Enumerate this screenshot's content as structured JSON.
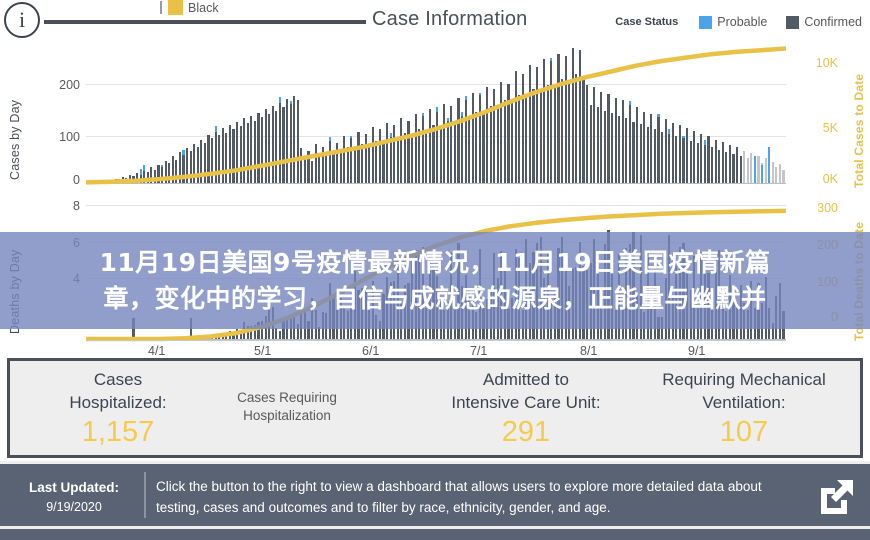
{
  "header": {
    "info_icon": "info-icon",
    "title": "Case Information",
    "legend_black_label": "Black",
    "case_status_label": "Case Status",
    "probable_label": "Probable",
    "confirmed_label": "Confirmed",
    "colors": {
      "gold": "#E8C146",
      "probable": "#4BA3EC",
      "confirmed": "#525A66",
      "dark": "#4A5059"
    }
  },
  "chart_data": {
    "type": "bar",
    "title": "Case Information",
    "xlabel": "",
    "legend": [
      "Black",
      "Probable",
      "Confirmed"
    ],
    "legend_position": "top",
    "grid": true,
    "panels": [
      {
        "name": "cases",
        "ylabel": "Cases by Day",
        "y2label": "Total Cases to Date",
        "yticks": [
          "0",
          "100",
          "200"
        ],
        "ylim": [
          0,
          260
        ],
        "y2ticks": [
          "0K",
          "5K",
          "10K"
        ],
        "y2lim": [
          0,
          12000
        ],
        "xticks": [
          "4/1",
          "5/1",
          "6/1",
          "7/1",
          "8/1",
          "9/1"
        ],
        "series": [
          {
            "name": "Confirmed",
            "type": "bar",
            "color": "#525A66",
            "values": [
              2,
              1,
              3,
              2,
              4,
              3,
              6,
              5,
              8,
              7,
              11,
              9,
              14,
              12,
              18,
              15,
              22,
              19,
              28,
              24,
              33,
              29,
              40,
              35,
              48,
              42,
              55,
              50,
              62,
              57,
              70,
              64,
              78,
              72,
              86,
              80,
              92,
              86,
              98,
              90,
              104,
              96,
              110,
              102,
              116,
              108,
              120,
              112,
              126,
              118,
              132,
              124,
              138,
              130,
              144,
              136,
              150,
              142,
              156,
              148,
              62,
              44,
              58,
              40,
              70,
              52,
              64,
              48,
              76,
              58,
              72,
              54,
              84,
              64,
              80,
              60,
              92,
              70,
              88,
              66,
              100,
              76,
              96,
              72,
              108,
              82,
              104,
              78,
              116,
              90,
              112,
              86,
              124,
              96,
              120,
              92,
              132,
              104,
              128,
              100,
              142,
              112,
              138,
              108,
              152,
              120,
              148,
              116,
              162,
              128,
              158,
              124,
              172,
              138,
              168,
              134,
              182,
              148,
              178,
              144,
              200,
              158,
              196,
              154,
              212,
              168,
              208,
              164,
              222,
              176,
              218,
              172,
              232,
              186,
              228,
              182,
              242,
              196,
              238,
              192,
              176,
              140,
              172,
              136,
              164,
              130,
              160,
              126,
              152,
              120,
              148,
              116,
              140,
              110,
              136,
              106,
              128,
              100,
              124,
              96,
              118,
              92,
              114,
              88,
              108,
              84,
              104,
              80,
              98,
              76,
              94,
              72,
              88,
              68,
              84,
              64,
              78,
              60,
              74,
              56,
              68,
              52,
              64,
              48,
              58,
              44,
              54,
              40,
              48,
              36,
              44,
              32,
              38,
              28,
              34,
              24
            ]
          },
          {
            "name": "Probable",
            "type": "bar-overlay",
            "color": "#4BA3EC",
            "note": "small blue caps stacked on top of selected confirmed bars"
          },
          {
            "name": "Total Cases to Date",
            "type": "line",
            "color": "#E8C146",
            "axis": "right",
            "values_k": [
              0.05,
              0.1,
              0.2,
              0.35,
              0.55,
              0.8,
              1.1,
              1.5,
              1.9,
              2.3,
              2.7,
              3.1,
              3.6,
              4.1,
              4.7,
              5.4,
              6.2,
              7.1,
              7.9,
              8.6,
              9.2,
              9.7,
              10.2,
              10.6,
              10.9,
              11.2,
              11.4,
              11.55,
              11.7
            ]
          }
        ]
      },
      {
        "name": "deaths",
        "ylabel": "Deaths by Day",
        "y2label": "Total Deaths to Date",
        "yticks": [
          "8",
          "6",
          "4"
        ],
        "ylim": [
          0,
          9
        ],
        "y2ticks": [
          "0",
          "100",
          "200",
          "300"
        ],
        "y2lim": [
          0,
          330
        ],
        "series": [
          {
            "name": "Deaths by Day",
            "type": "bar",
            "color": "#525A66"
          },
          {
            "name": "Total Deaths to Date",
            "type": "line",
            "color": "#E8C146",
            "axis": "right"
          }
        ]
      }
    ]
  },
  "overlay": {
    "line1": "11月19日美国9号疫情最新情况，11月19日美国疫情新篇",
    "line2": "章，变化中的学习，自信与成就感的源泉，正能量与幽默并",
    "bg_color": "#7684BD"
  },
  "hospital_panel": {
    "columns": [
      {
        "title_line1": "Cases",
        "title_line2": "Hospitalized:",
        "value": "1,157"
      },
      {
        "title_line1": "Cases Requiring",
        "title_line2": "Hospitalization",
        "value": ""
      },
      {
        "title_line1": "Admitted to",
        "title_line2": "Intensive Care Unit:",
        "value": "291"
      },
      {
        "title_line1": "Requiring Mechanical",
        "title_line2": "Ventilation:",
        "value": "107"
      }
    ],
    "value_color": "#F5CA4D"
  },
  "footer": {
    "last_updated_label": "Last Updated:",
    "last_updated_value": "9/19/2020",
    "description": "Click the button to the right to view a dashboard that allows users to explore more detailed data about testing, cases and outcomes and to filter by race, ethnicity, gender, and age.",
    "button_icon": "external-link-icon",
    "bg_color": "#5A6373"
  }
}
